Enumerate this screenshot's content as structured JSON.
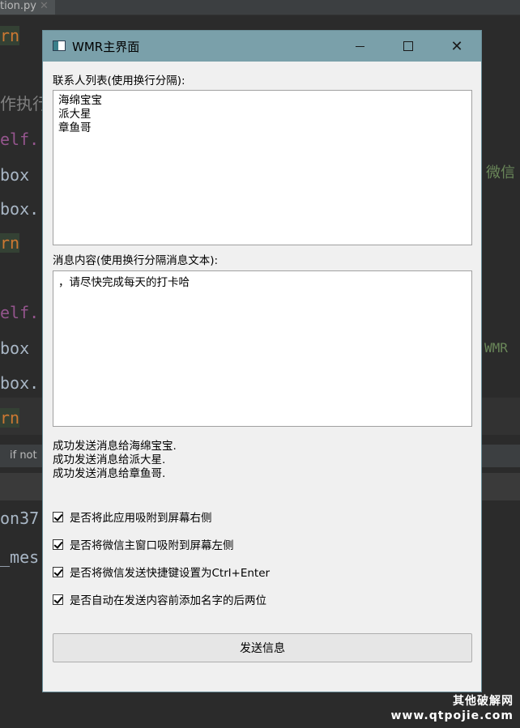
{
  "ide": {
    "tab": "tion.py",
    "code_lines": [
      "rn",
      "作执行",
      "elf.",
      "box",
      "box.",
      "rn",
      "elf.",
      "box",
      "box.",
      "rn",
      "on37",
      "_mes"
    ],
    "right_text_1": "微信",
    "right_text_2": "WMR",
    "hint": "if not"
  },
  "window": {
    "title": "WMR主界面",
    "contacts_label": "联系人列表(使用换行分隔):",
    "contacts_value": "海绵宝宝\n派大星\n章鱼哥",
    "message_label": "消息内容(使用换行分隔消息文本):",
    "message_value": "，请尽快完成每天的打卡哈",
    "status_lines": [
      "成功发送消息给海绵宝宝.",
      "成功发送消息给派大星.",
      "成功发送消息给章鱼哥."
    ],
    "options": [
      {
        "label": "是否将此应用吸附到屏幕右侧",
        "checked": true
      },
      {
        "label": "是否将微信主窗口吸附到屏幕左侧",
        "checked": true
      },
      {
        "label": "是否将微信发送快捷键设置为Ctrl+Enter",
        "checked": true
      },
      {
        "label": "是否自动在发送内容前添加名字的后两位",
        "checked": true
      }
    ],
    "send_button": "发送信息"
  },
  "watermark": {
    "line1": "其他破解网",
    "line2": "www.qtpojie.com"
  }
}
